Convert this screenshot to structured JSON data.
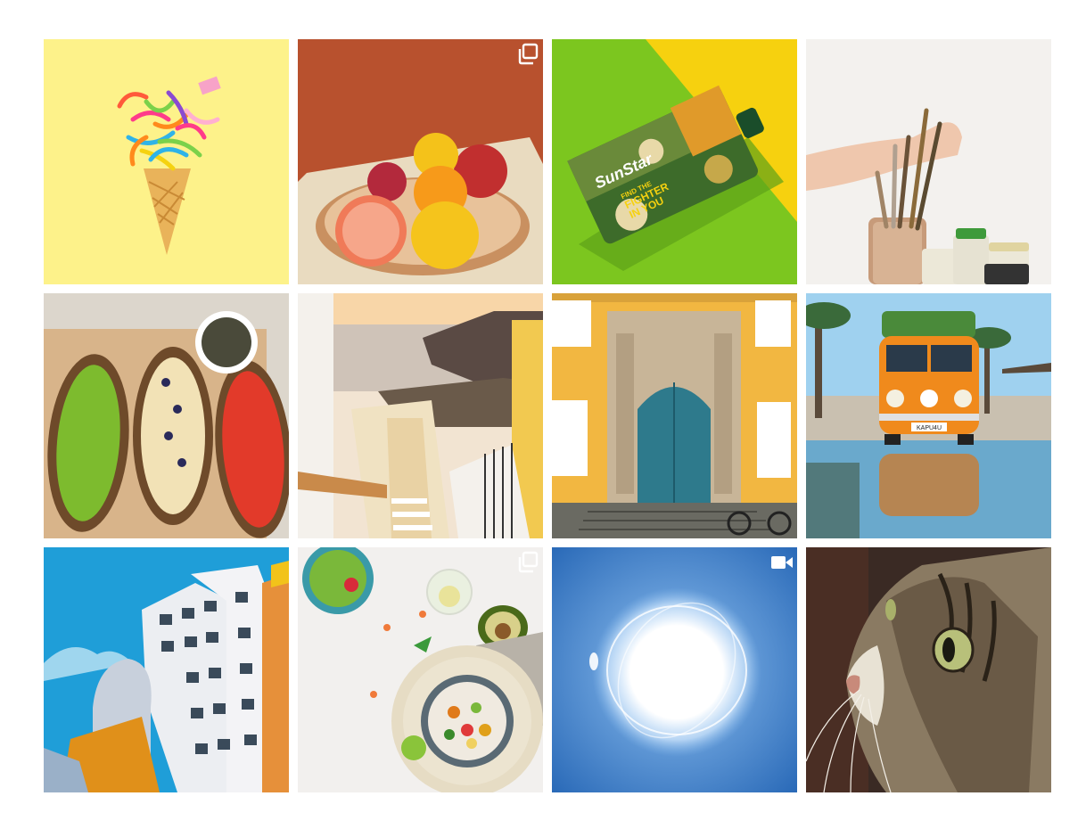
{
  "grid": {
    "posts": [
      {
        "label": "Confetti ice cream cone",
        "badge": "none"
      },
      {
        "label": "Fruit bowl with grapefruit and lemons",
        "badge": "carousel"
      },
      {
        "label": "SunStar juice carton",
        "badge": "none",
        "carton": {
          "brand": "SunStar",
          "line1": "FIND THE",
          "line2": "FIGHTER",
          "line3": "IN YOU"
        }
      },
      {
        "label": "Paint brushes in jar",
        "badge": "none"
      },
      {
        "label": "Avocado and fruit toasts",
        "badge": "none"
      },
      {
        "label": "Santorini stairway",
        "badge": "none"
      },
      {
        "label": "Yellow baroque building facade",
        "badge": "none"
      },
      {
        "label": "Orange VW van at the beach",
        "badge": "none",
        "van_plate": "KAPU4U"
      },
      {
        "label": "Deconstructivist building",
        "badge": "none"
      },
      {
        "label": "Salad bowl and avocado",
        "badge": "carousel"
      },
      {
        "label": "Sun in blue sky",
        "badge": "video"
      },
      {
        "label": "Tabby cat close-up",
        "badge": "none"
      }
    ]
  }
}
